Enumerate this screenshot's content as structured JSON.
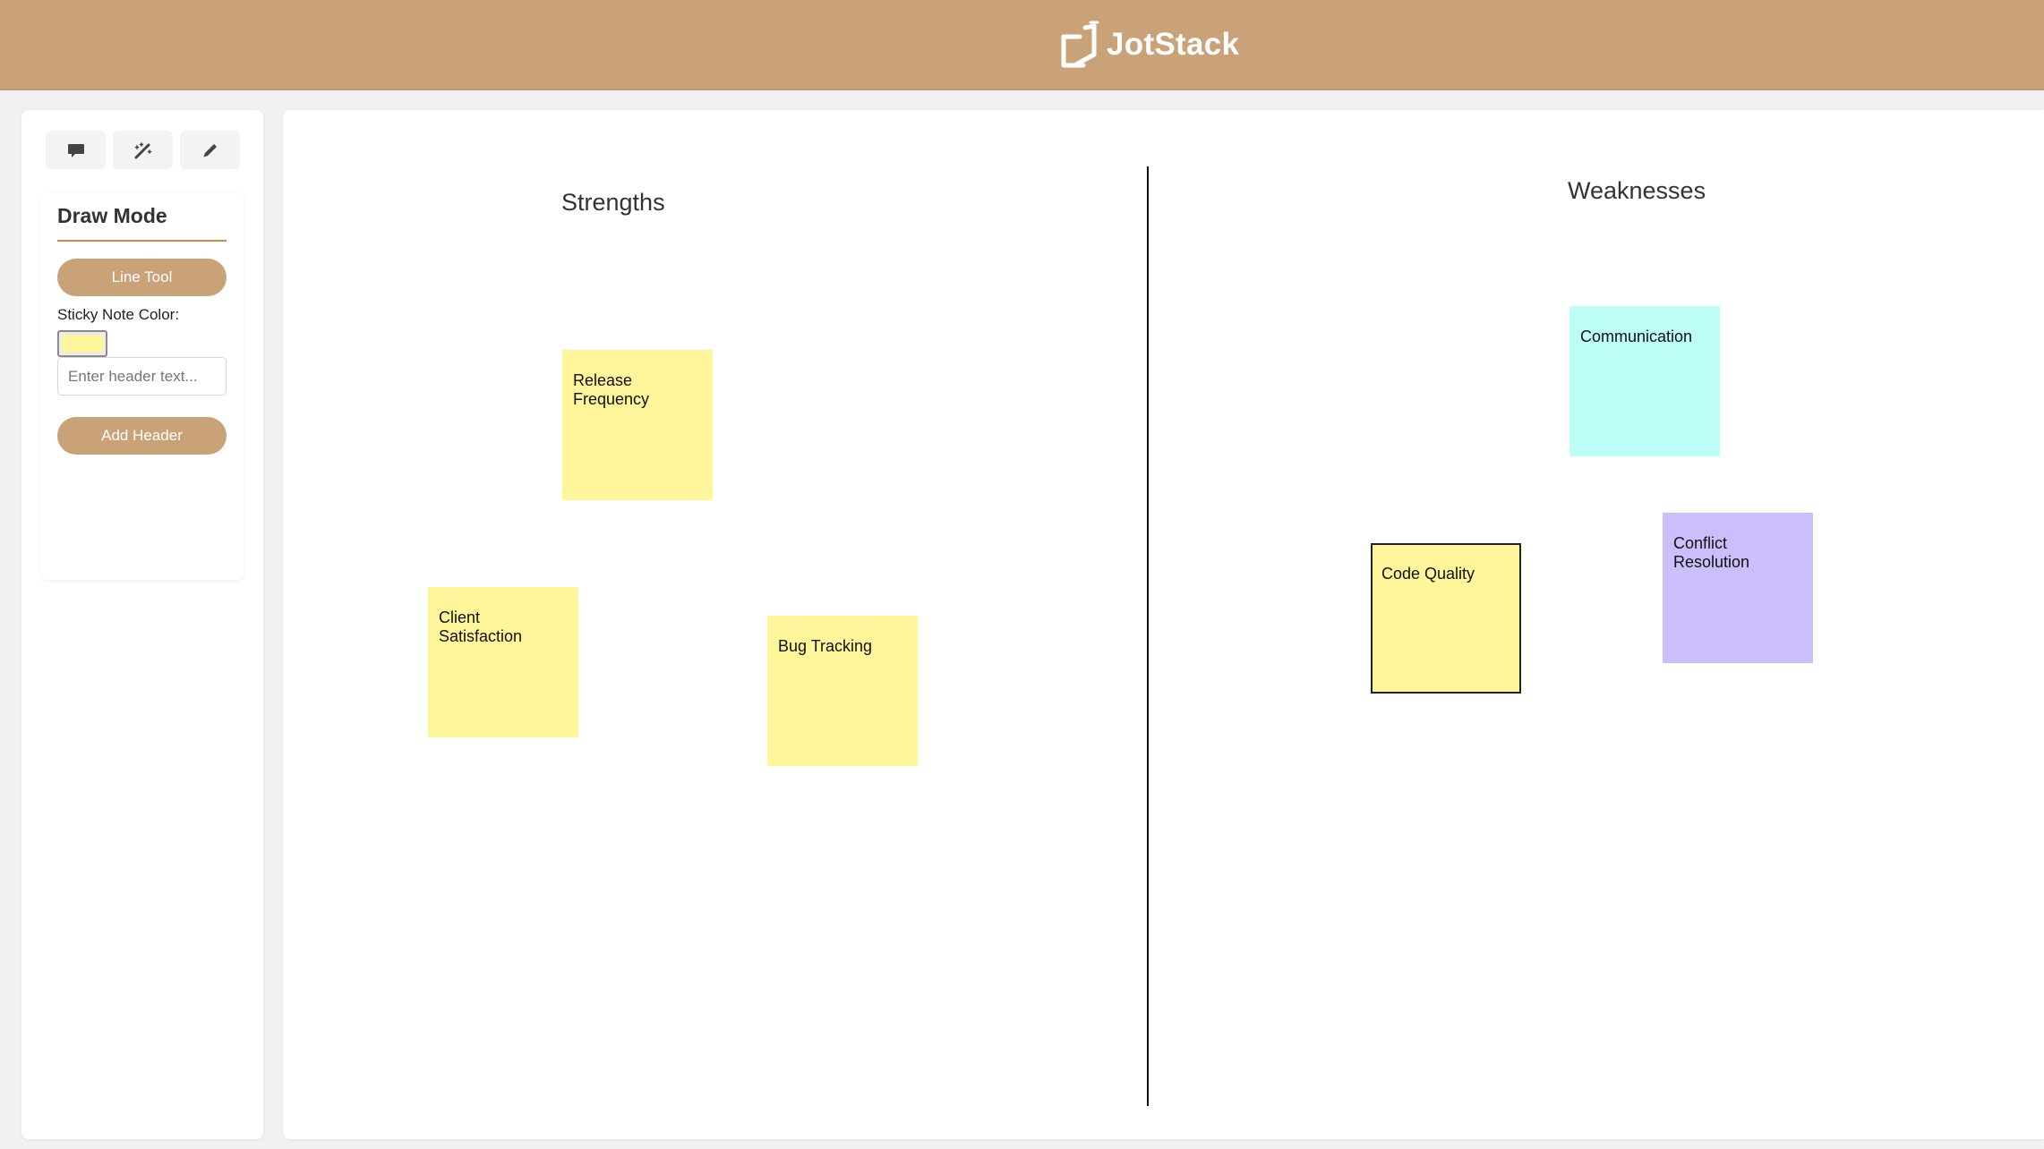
{
  "header": {
    "app_name": "JotStack",
    "logo_icon": "jotstack-logo-icon",
    "background_color": "#c9a277"
  },
  "sidebar": {
    "tools": [
      {
        "name": "sticky-note-tool",
        "icon": "comment-icon"
      },
      {
        "name": "magic-wand-tool",
        "icon": "magic-wand-icon"
      },
      {
        "name": "draw-tool",
        "icon": "pencil-icon"
      }
    ],
    "panel": {
      "title": "Draw Mode",
      "line_tool_label": "Line Tool",
      "color_label": "Sticky Note Color:",
      "selected_color": "#fff59a",
      "header_input_value": "",
      "header_input_placeholder": "Enter header text...",
      "add_header_label": "Add Header"
    }
  },
  "board": {
    "headers": [
      {
        "text": "Strengths"
      },
      {
        "text": "Weaknesses"
      }
    ],
    "notes": [
      {
        "text": "Release\nFrequency",
        "color": "#fff59a",
        "selected": false
      },
      {
        "text": "Client\nSatisfaction",
        "color": "#fff59a",
        "selected": false
      },
      {
        "text": "Bug Tracking",
        "color": "#fff59a",
        "selected": false
      },
      {
        "text": "Communication",
        "color": "#bdfdf8",
        "selected": false
      },
      {
        "text": "Code Quality",
        "color": "#fff59a",
        "selected": true
      },
      {
        "text": "Conflict\nResolution",
        "color": "#cbbefa",
        "selected": false
      }
    ]
  }
}
